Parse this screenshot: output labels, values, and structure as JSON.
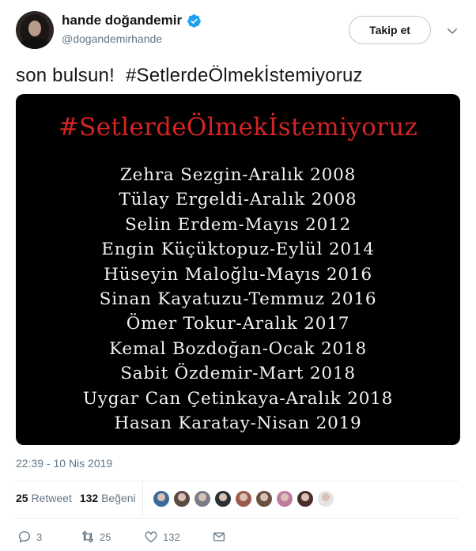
{
  "author": {
    "display_name": "hande doğandemir",
    "handle": "@dogandemirhande",
    "verified": true
  },
  "follow_button": {
    "label": "Takip et"
  },
  "tweet": {
    "text_part1": "son bulsun!",
    "text_part2": "#SetlerdeÖlmekİstemiyoruz"
  },
  "media": {
    "title": "#SetlerdeÖlmekİstemiyoruz",
    "title_color": "#d42424",
    "lines": [
      "Zehra Sezgin-Aralık 2008",
      "Tülay Ergeldi-Aralık 2008",
      "Selin Erdem-Mayıs 2012",
      "Engin Küçüktopuz-Eylül 2014",
      "Hüseyin Maloğlu-Mayıs 2016",
      "Sinan Kayatuzu-Temmuz 2016",
      "Ömer Tokur-Aralık 2017",
      "Kemal Bozdoğan-Ocak 2018",
      "Sabit Özdemir-Mart 2018",
      "Uygar Can Çetinkaya-Aralık 2018",
      "Hasan Karatay-Nisan 2019"
    ]
  },
  "timestamp": "22:39 - 10 Nis 2019",
  "stats": {
    "retweets_count": "25",
    "retweets_label": "Retweet",
    "likes_count": "132",
    "likes_label": "Beğeni"
  },
  "likers": [
    {
      "color": "#3a6b9a"
    },
    {
      "color": "#5a4a44"
    },
    {
      "color": "#7b7c8a"
    },
    {
      "color": "#2b2f36"
    },
    {
      "color": "#9a5a4e"
    },
    {
      "color": "#6b5040"
    },
    {
      "color": "#c07aa0"
    },
    {
      "color": "#4a2e2a"
    },
    {
      "color": "#e4e4e4"
    }
  ],
  "actions": {
    "reply_count": "3",
    "retweet_count": "25",
    "like_count": "132"
  },
  "colors": {
    "verified_blue": "#1da1f2",
    "secondary_text": "#657786"
  }
}
